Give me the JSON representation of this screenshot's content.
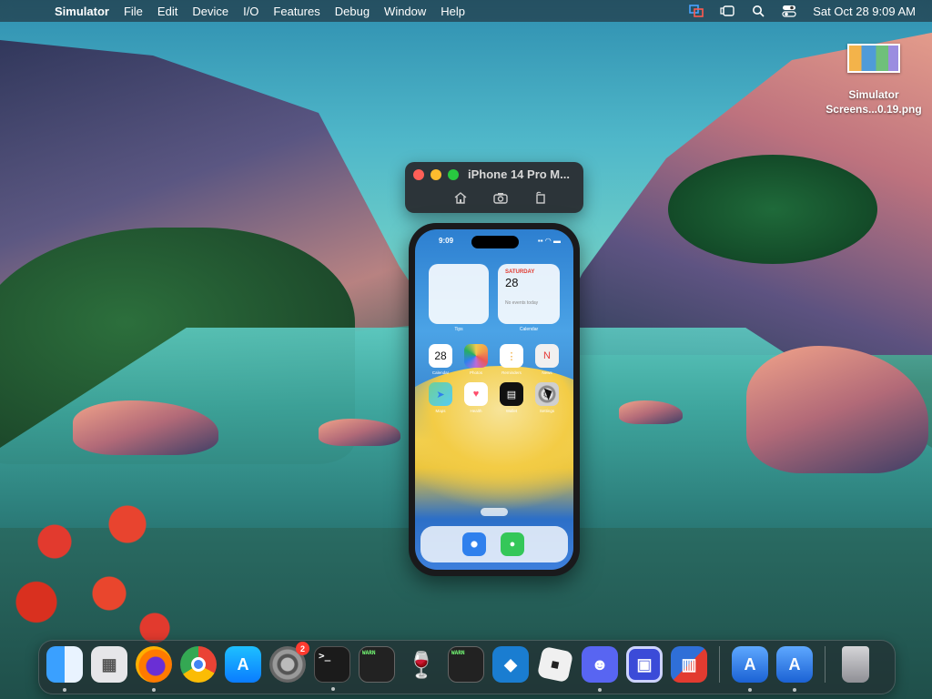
{
  "menubar": {
    "apple": "",
    "app_name": "Simulator",
    "items": [
      "File",
      "Edit",
      "Device",
      "I/O",
      "Features",
      "Debug",
      "Window",
      "Help"
    ],
    "datetime": "Sat Oct 28  9:09 AM"
  },
  "desktop_file": {
    "line1": "Simulator",
    "line2": "Screens...0.19.png"
  },
  "simulator_window": {
    "title": "iPhone 14 Pro M...",
    "tools": [
      "home-icon",
      "screenshot-icon",
      "rotate-icon"
    ]
  },
  "phone": {
    "status_time": "9:09",
    "status_icons": "▪▪ ◠ ▬",
    "widget_calendar": {
      "day": "SATURDAY",
      "date": "28",
      "events": "No events today"
    },
    "widget_labels": [
      "Tips",
      "Calendar"
    ],
    "apps_row1": [
      {
        "name": "Calendar",
        "glyph": "28"
      },
      {
        "name": "Photos",
        "glyph": ""
      },
      {
        "name": "Reminders",
        "glyph": "⋮"
      },
      {
        "name": "News",
        "glyph": "N"
      }
    ],
    "apps_row2": [
      {
        "name": "Maps",
        "glyph": "➤"
      },
      {
        "name": "Health",
        "glyph": "♥"
      },
      {
        "name": "Wallet",
        "glyph": "▤"
      },
      {
        "name": "Settings",
        "glyph": "⚙"
      }
    ],
    "dock_apps": [
      {
        "name": "Safari",
        "glyph": "✦"
      },
      {
        "name": "Messages",
        "glyph": "●"
      }
    ]
  },
  "dock": {
    "items": [
      {
        "name": "Finder",
        "glyph": ""
      },
      {
        "name": "Launchpad",
        "glyph": "▦"
      },
      {
        "name": "Firefox",
        "glyph": ""
      },
      {
        "name": "Chrome",
        "glyph": ""
      },
      {
        "name": "App Store",
        "glyph": "A"
      },
      {
        "name": "System Settings",
        "glyph": "",
        "badge": "2"
      },
      {
        "name": "Terminal",
        "glyph": ">_"
      },
      {
        "name": "Console",
        "glyph": "WARN"
      },
      {
        "name": "Wine",
        "glyph": "🍷"
      },
      {
        "name": "Console 2",
        "glyph": "WARN"
      },
      {
        "name": "Visual Studio Code",
        "glyph": "◆"
      },
      {
        "name": "Roblox",
        "glyph": "■"
      },
      {
        "name": "Discord",
        "glyph": "☻"
      },
      {
        "name": "Frame",
        "glyph": "▣"
      },
      {
        "name": "Parallels",
        "glyph": "▥"
      },
      {
        "name": "Xcode",
        "glyph": "A"
      },
      {
        "name": "Simulator",
        "glyph": "A"
      },
      {
        "name": "Trash",
        "glyph": ""
      }
    ]
  }
}
